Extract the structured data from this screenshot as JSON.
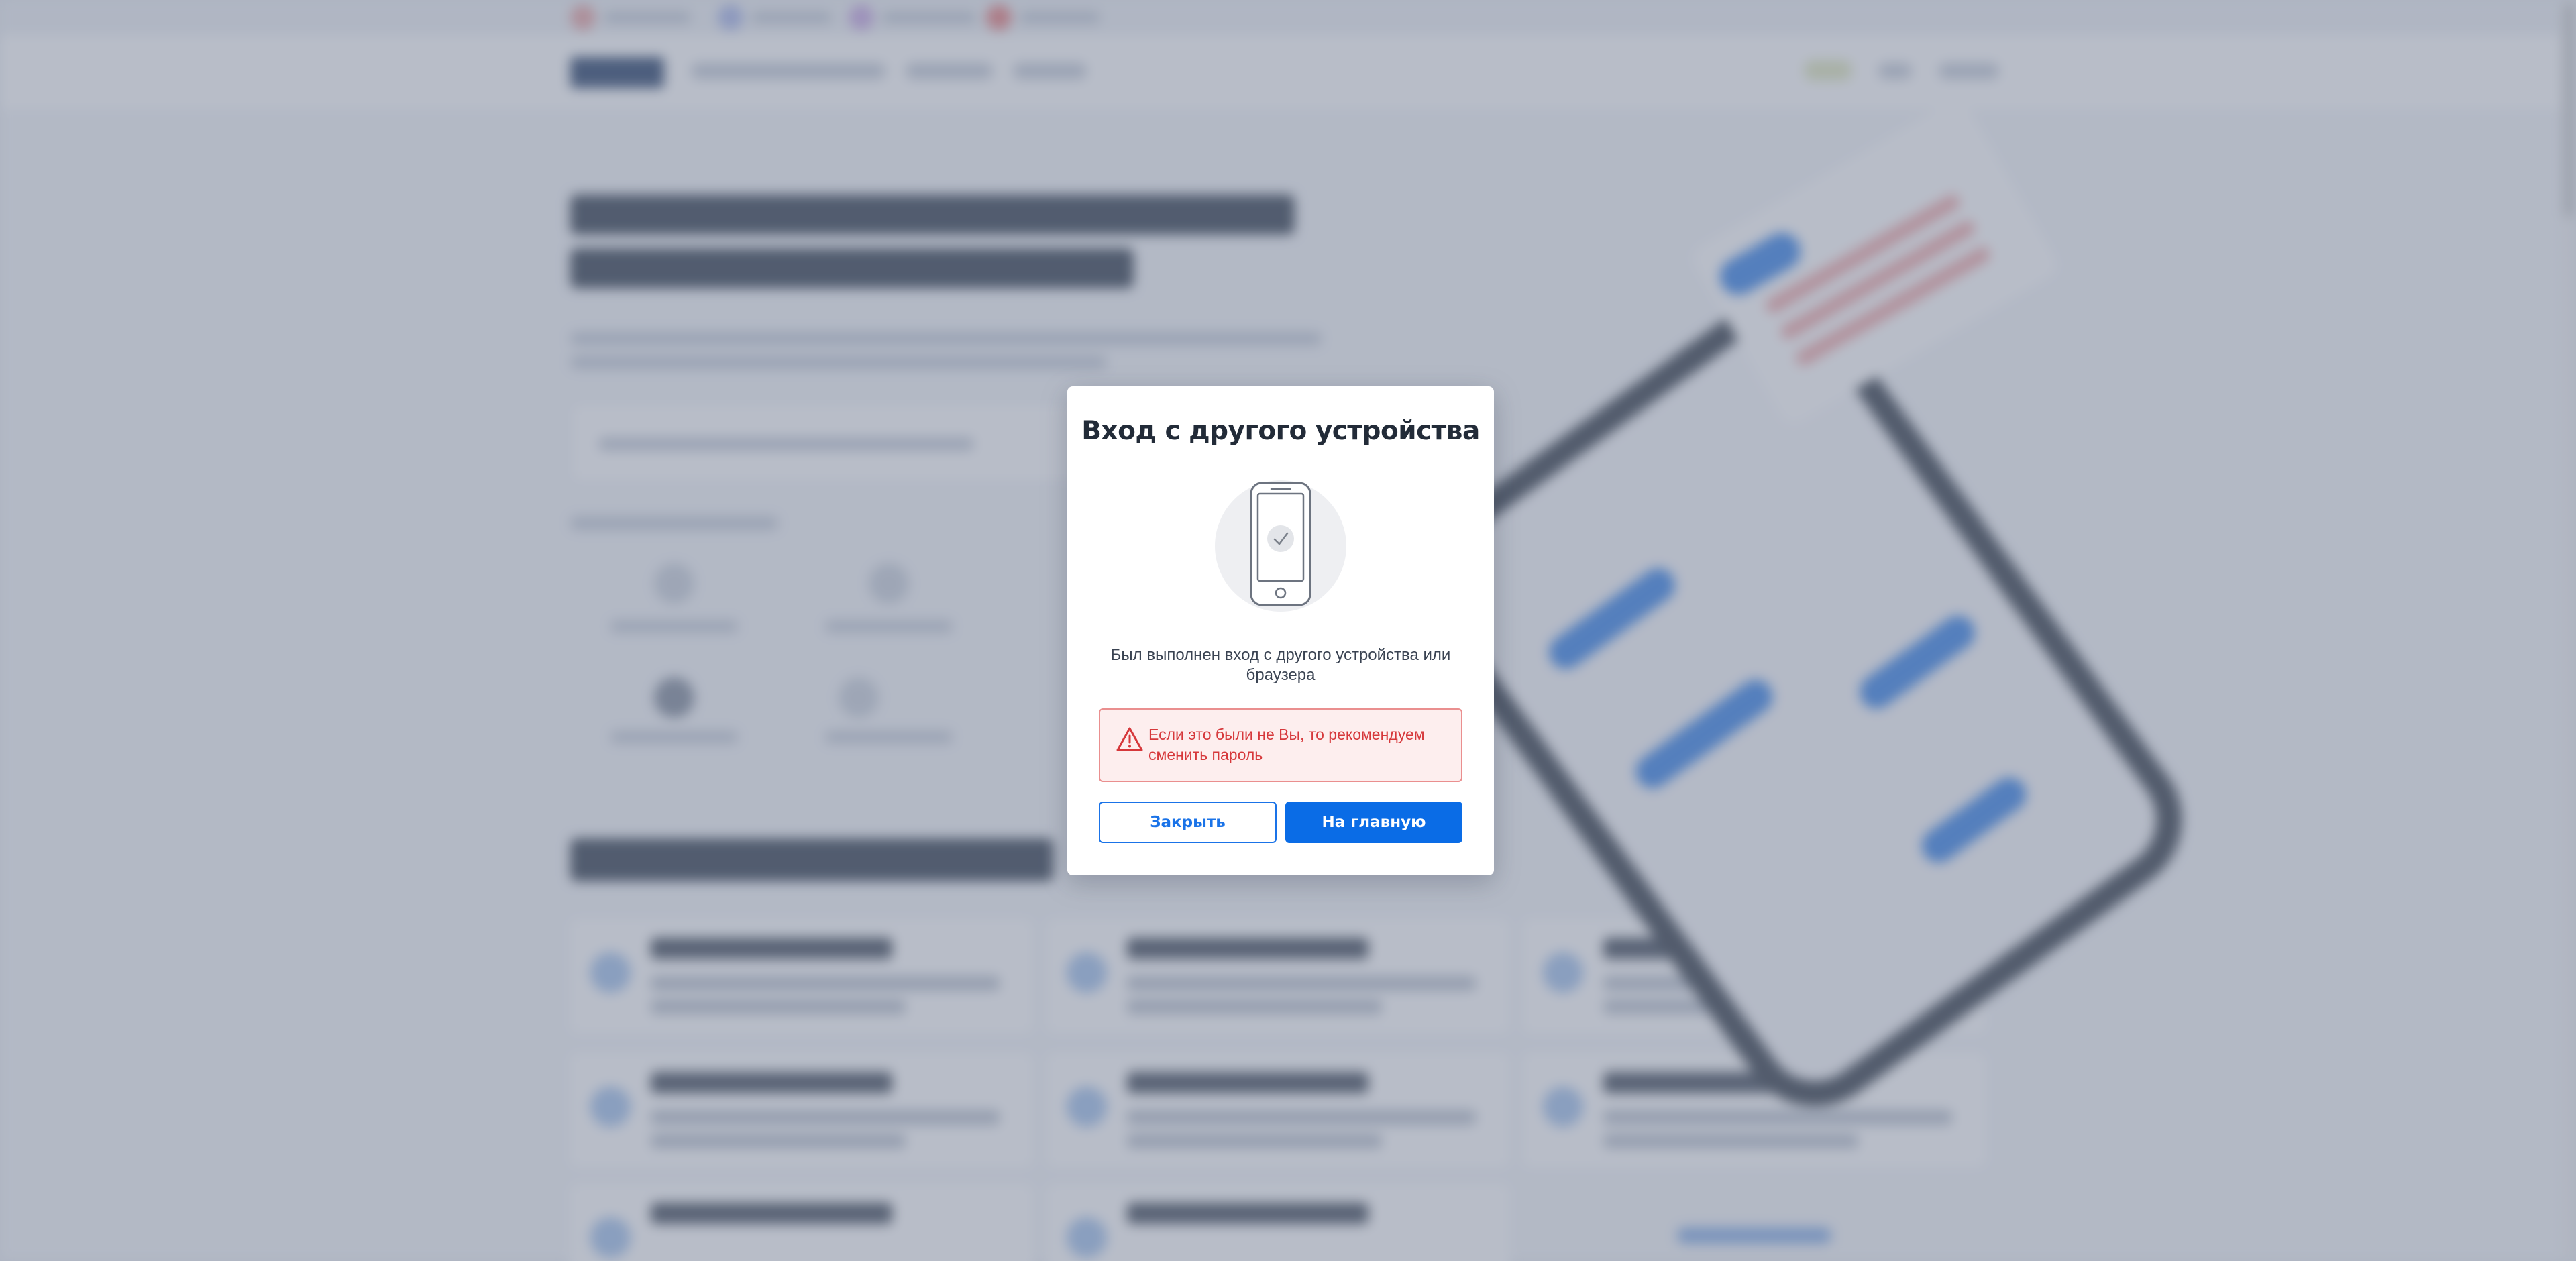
{
  "modal": {
    "title": "Вход с другого устройства",
    "message": "Был выполнен вход с другого устройства или браузера",
    "warning": "Если это были не Вы, то рекомендуем сменить пароль",
    "close_label": "Закрыть",
    "home_label": "На главную"
  },
  "icons": {
    "device": "phone-check-icon",
    "warning": "warning-triangle-icon"
  },
  "colors": {
    "primary": "#0a6ce6",
    "warning_text": "#d6383b",
    "warning_bg": "#fdeeee",
    "warning_border": "#ea8f8f",
    "overlay": "#76809a"
  }
}
